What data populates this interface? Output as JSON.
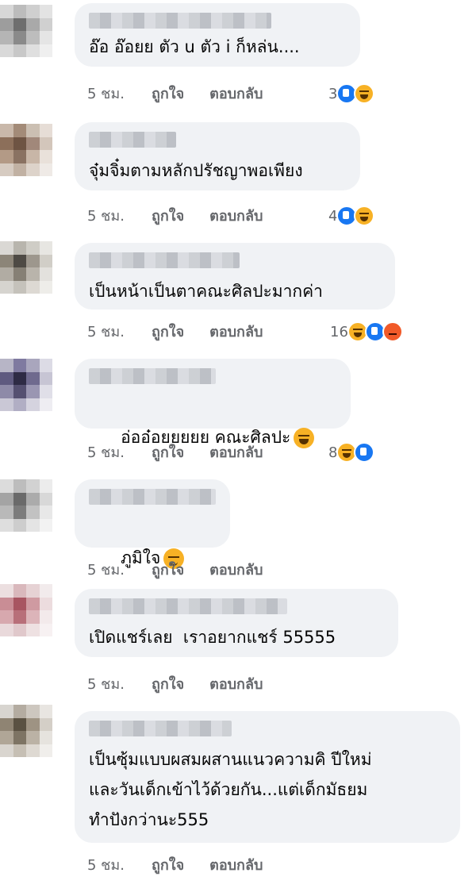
{
  "comments": [
    {
      "time": "5 ชม.",
      "like": "ถูกใจ",
      "reply": "ตอบกลับ",
      "text": "อ๊อ อ๊อยย ตัว u ตัว i ก็หล่น....",
      "reaction_count": "3",
      "reactions": [
        "like",
        "haha"
      ]
    },
    {
      "time": "5 ชม.",
      "like": "ถูกใจ",
      "reply": "ตอบกลับ",
      "text": "จุ๋มจิ๋มตามหลักปรัชญาพอเพียง",
      "reaction_count": "4",
      "reactions": [
        "like",
        "haha"
      ]
    },
    {
      "time": "5 ชม.",
      "like": "ถูกใจ",
      "reply": "ตอบกลับ",
      "text": "เป็นหน้าเป็นตาคณะศิลปะมากค่า",
      "reaction_count": "16",
      "reactions": [
        "haha",
        "like",
        "angry"
      ]
    },
    {
      "time": "5 ชม.",
      "like": "ถูกใจ",
      "reply": "ตอบกลับ",
      "text": "อ่ออ๋อยยยยย คณะศิลปะ",
      "reaction_count": "8",
      "reactions": [
        "haha",
        "like"
      ]
    },
    {
      "time": "5 ชม.",
      "like": "ถูกใจ",
      "reply": "ตอบกลับ",
      "text": "ภูมิใจ"
    },
    {
      "time": "5 ชม.",
      "like": "ถูกใจ",
      "reply": "ตอบกลับ",
      "text": "เปิดแชร์เลย  เราอยากแชร์ 55555"
    },
    {
      "time": "5 ชม.",
      "like": "ถูกใจ",
      "reply": "ตอบกลับ",
      "text": "เป็นซุ้มแบบผสมผสานแนวความคิ ปีใหม่\nและวันเด็กเข้าไว้ด้วยกัน...แต่เด็กมัธยม\nทำปังกว่านะ555"
    }
  ],
  "colors": {
    "bubble": "#f0f2f5",
    "meta": "#65676b",
    "like": "#1877f2",
    "haha": "#f7b125",
    "angry": "#f15a29"
  },
  "icons": {
    "like": "like-reaction-icon",
    "haha": "haha-reaction-icon",
    "angry": "angry-reaction-icon",
    "cry_laugh": "laughing-crying-emoji",
    "relieved": "relieved-face-emoji"
  }
}
